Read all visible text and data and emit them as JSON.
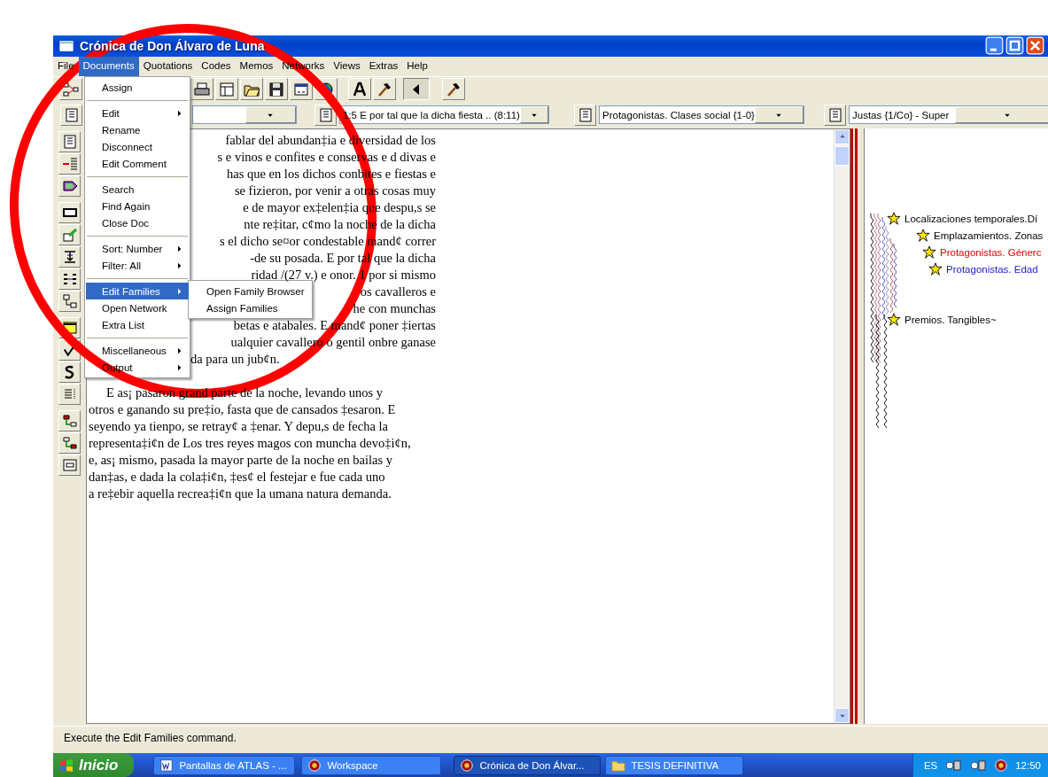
{
  "window": {
    "title": "Crónica de Don Álvaro de Luna"
  },
  "menu_bar": [
    {
      "label": "File",
      "selected": false
    },
    {
      "label": "Documents",
      "selected": true
    },
    {
      "label": "Quotations",
      "selected": false
    },
    {
      "label": "Codes",
      "selected": false
    },
    {
      "label": "Memos",
      "selected": false
    },
    {
      "label": "Networks",
      "selected": false
    },
    {
      "label": "Views",
      "selected": false
    },
    {
      "label": "Extras",
      "selected": false
    },
    {
      "label": "Help",
      "selected": false
    }
  ],
  "documents_menu": [
    {
      "kind": "item",
      "label": "Assign",
      "has_submenu": false,
      "selected": false
    },
    {
      "kind": "separator"
    },
    {
      "kind": "item",
      "label": "Edit",
      "has_submenu": true,
      "selected": false
    },
    {
      "kind": "item",
      "label": "Rename",
      "has_submenu": false,
      "selected": false
    },
    {
      "kind": "item",
      "label": "Disconnect",
      "has_submenu": false,
      "selected": false
    },
    {
      "kind": "item",
      "label": "Edit Comment",
      "has_submenu": false,
      "selected": false
    },
    {
      "kind": "separator"
    },
    {
      "kind": "item",
      "label": "Search",
      "has_submenu": false,
      "selected": false
    },
    {
      "kind": "item",
      "label": "Find Again",
      "has_submenu": false,
      "selected": false
    },
    {
      "kind": "item",
      "label": "Close Doc",
      "has_submenu": false,
      "selected": false
    },
    {
      "kind": "separator"
    },
    {
      "kind": "item",
      "label": "Sort: Number",
      "has_submenu": true,
      "selected": false
    },
    {
      "kind": "item",
      "label": "Filter: All",
      "has_submenu": true,
      "selected": false
    },
    {
      "kind": "separator"
    },
    {
      "kind": "item",
      "label": "Edit Families",
      "has_submenu": true,
      "selected": true
    },
    {
      "kind": "item",
      "label": "Open Network",
      "has_submenu": false,
      "selected": false
    },
    {
      "kind": "item",
      "label": "Extra List",
      "has_submenu": false,
      "selected": false
    },
    {
      "kind": "separator"
    },
    {
      "kind": "item",
      "label": "Miscellaneous",
      "has_submenu": true,
      "selected": false
    },
    {
      "kind": "item",
      "label": "Output",
      "has_submenu": true,
      "selected": false
    }
  ],
  "families_submenu": [
    "Open Family Browser",
    "Assign Families"
  ],
  "selectors": [
    "1:5 E por tal que la dicha fiesta .. (8:11)",
    "Protagonistas. Clases social {1-0}",
    "Justas {1/Co} - Super"
  ],
  "document": {
    "paragraphs": [
      {
        "kind": "covered",
        "lines": [
          "fablar del abundan‡ia e diversidad de los",
          "s e vinos e confites e conservas e d divas e",
          "has que en los dichos conbites e fiestas e",
          "se fizieron, por venir a otras cosas muy",
          "e de mayor ex‡elen‡ia que despu,s se",
          "nte re‡itar, c¢mo la noche de la dicha",
          "s el dicho se¤or condestable mand¢ correr",
          "-de su posada. E por tal que la dicha",
          "ridad /(27 v.) e onor. 1 por si mismo",
          "os cavalleros e",
          "he con munchas",
          "betas e atabales. E mand¢ poner ‡iertas",
          "ualquier cavallero o gentil onbre ganase",
          "da para un jub¢n."
        ]
      },
      {
        "kind": "plain",
        "lines": [
          "E as¡ pasaron grand parte de la noche, levando unos y",
          "otros e ganando su pre‡io, fasta que de cansados ‡esaron. E",
          "seyendo ya tienpo, se retray¢ a ‡enar. Y depu,s de fecha la",
          "representa‡i¢n de Los tres reyes magos con muncha devo‡i¢n,",
          "e, as¡ mismo, pasada la mayor parte de la noche en bailas y",
          "dan‡as, e dada la cola‡i¢n, ‡es¢ el festejar e fue cada uno",
          "a re‡ebir aquella recrea‡i¢n que la umana natura demanda."
        ]
      }
    ]
  },
  "margin_codes": [
    {
      "label": "Localizaciones temporales.Dí",
      "color": "#000000"
    },
    {
      "label": "Emplazamientos. Zonas",
      "color": "#000000"
    },
    {
      "label": "Protagonistas. Génerc",
      "color": "#e00000"
    },
    {
      "label": "Protagonistas. Edad",
      "color": "#1c1cc8"
    },
    {
      "label": "Premios. Tangibles~",
      "color": "#000000"
    }
  ],
  "status_bar": {
    "text": "Execute the Edit Families command."
  },
  "taskbar": {
    "start": "Inicio",
    "tasks": [
      {
        "label": "Pantallas de ATLAS - ...",
        "kind": "word",
        "selected": false
      },
      {
        "label": "Workspace",
        "kind": "app",
        "selected": false
      },
      {
        "label": "Crónica de Don Álvar...",
        "kind": "app",
        "selected": true
      },
      {
        "label": "TESIS DEFINITIVA",
        "kind": "folder",
        "selected": false
      }
    ],
    "language": "ES",
    "clock": "12:50"
  }
}
